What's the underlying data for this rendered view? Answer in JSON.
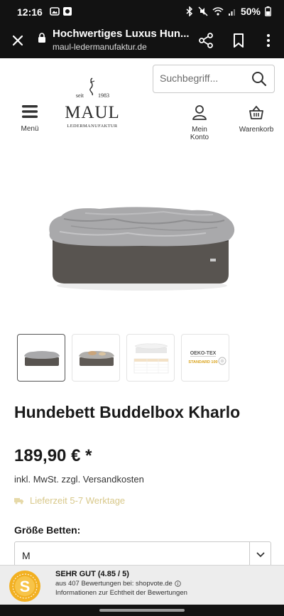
{
  "status_bar": {
    "time": "12:16",
    "battery": "50%"
  },
  "browser": {
    "page_title": "Hochwertiges Luxus Hun...",
    "url": "maul-ledermanufaktur.de"
  },
  "header": {
    "search_placeholder": "Suchbegriff...",
    "menu_label": "Menü",
    "account_label": "Mein Konto",
    "cart_label": "Warenkorb",
    "logo": {
      "top_text": "seit",
      "year": "1983",
      "brand": "MAUL",
      "sub": "LEDERMANUFAKTUR"
    }
  },
  "gallery": {
    "thumbnails": [
      {
        "name": "grey-bed",
        "active": true
      },
      {
        "name": "bed-with-toys",
        "active": false
      },
      {
        "name": "size-table",
        "active": false
      },
      {
        "name": "oeko-tex-label",
        "active": false
      }
    ],
    "oeko_tex_text": "OEKO-TEX",
    "oeko_tex_standard": "STANDARD 100"
  },
  "product": {
    "title": "Hundebett Buddelbox Kharlo",
    "price": "189,90 € *",
    "tax_note": "inkl. MwSt. zzgl. Versandkosten",
    "delivery": "Lieferzeit 5-7 Werktage",
    "size_label": "Größe Betten:",
    "size_value": "M"
  },
  "shopvote": {
    "seal_letter": "S",
    "rating_line": "SEHR GUT (4.85 / 5)",
    "reviews_line": "aus 407 Bewertungen bei: shopvote.de",
    "info_line": "Informationen zur Echtheit der Bewertungen"
  },
  "colors": {
    "delivery_text": "#d8c88a",
    "dark_bar": "#121212",
    "rating_bar": "#ededed",
    "seal_gold": "#f2b021"
  }
}
